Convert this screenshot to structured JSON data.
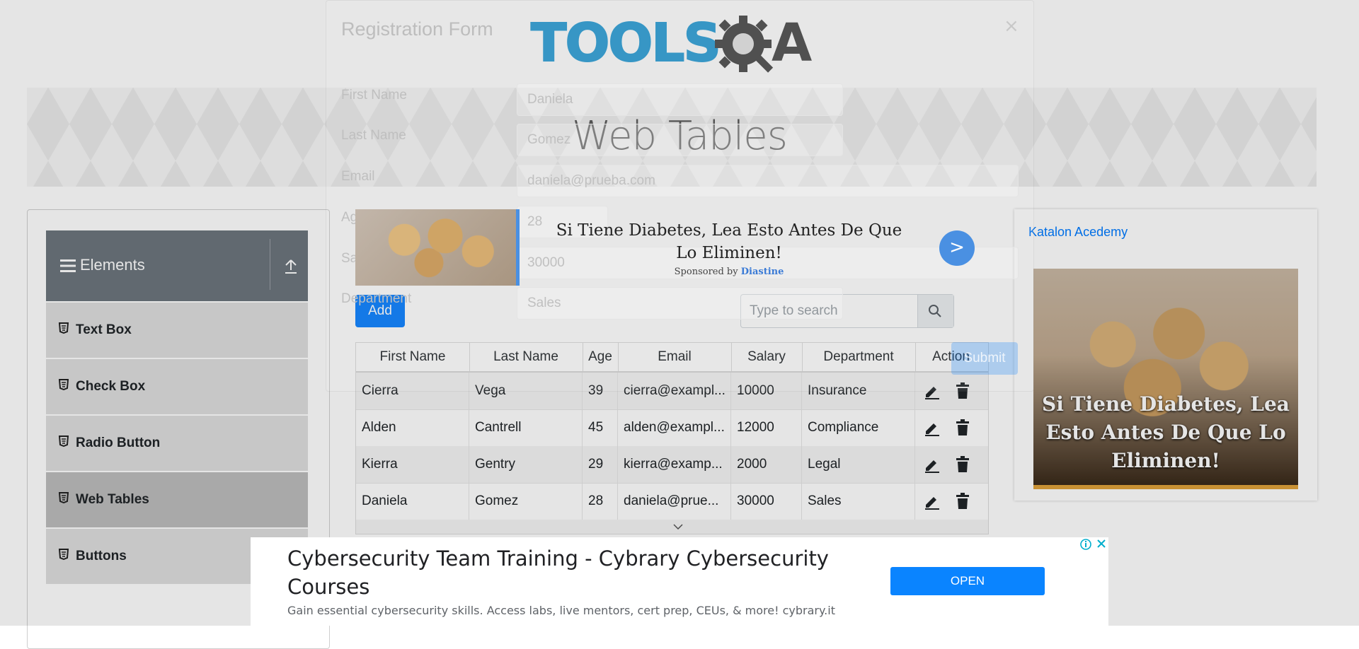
{
  "page": {
    "logo_text": "TOOLS",
    "logo_qa": "A",
    "title": "Web Tables"
  },
  "sidebar": {
    "group_title": "Elements",
    "items": [
      {
        "label": "Text Box"
      },
      {
        "label": "Check Box"
      },
      {
        "label": "Radio Button"
      },
      {
        "label": "Web Tables"
      },
      {
        "label": "Buttons"
      }
    ]
  },
  "controls": {
    "add_label": "Add",
    "search_placeholder": "Type to search"
  },
  "table": {
    "headers": [
      "First Name",
      "Last Name",
      "Age",
      "Email",
      "Salary",
      "Department",
      "Action"
    ],
    "rows": [
      [
        "Cierra",
        "Vega",
        "39",
        "cierra@exampl...",
        "10000",
        "Insurance"
      ],
      [
        "Alden",
        "Cantrell",
        "45",
        "alden@exampl...",
        "12000",
        "Compliance"
      ],
      [
        "Kierra",
        "Gentry",
        "29",
        "kierra@examp...",
        "2000",
        "Legal"
      ],
      [
        "Daniela",
        "Gomez",
        "28",
        "daniela@prue...",
        "30000",
        "Sales"
      ]
    ]
  },
  "modal": {
    "title": "Registration Form",
    "close": "×",
    "fields": {
      "first_name": {
        "label": "First Name",
        "value": "Daniela"
      },
      "last_name": {
        "label": "Last Name",
        "value": "Gomez"
      },
      "email": {
        "label": "Email",
        "value": "daniela@prueba.com"
      },
      "age": {
        "label": "Age",
        "value": "28"
      },
      "salary": {
        "label": "Salary",
        "value": "30000"
      },
      "department": {
        "label": "Department",
        "value": "Sales"
      }
    },
    "submit_label": "Submit"
  },
  "mid_ad": {
    "headline": "Si Tiene Diabetes, Lea Esto Antes De Que Lo Eliminen!",
    "sponsored_prefix": "Sponsored by",
    "sponsor": "Diastine",
    "next": ">"
  },
  "right_ad": {
    "link_text": "Katalon Acedemy",
    "caption": "Si Tiene Diabetes, Lea Esto Antes De Que Lo Eliminen!"
  },
  "bottom_ad": {
    "headline": "Cybersecurity Team Training - Cybrary Cybersecurity Courses",
    "description": "Gain essential cybersecurity skills. Access labs, live mentors, cert prep, CEUs, & more! cybrary.it",
    "open_label": "OPEN"
  },
  "colors": {
    "accent": "#007bff",
    "sidebar_header": "#6c757d",
    "logo_blue": "#2b9fd6"
  }
}
